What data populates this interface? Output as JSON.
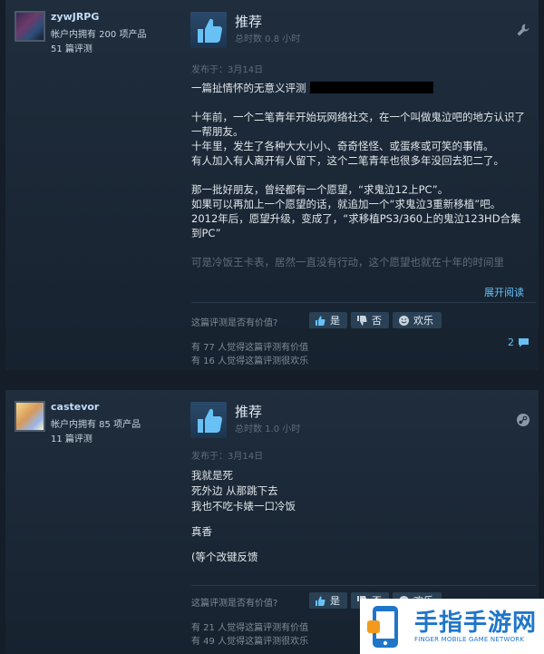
{
  "reviews": [
    {
      "user": {
        "name": "zywJRPG",
        "owned": "帐户内拥有 200 项产品",
        "reviews": "51 篇评测"
      },
      "verdict": "推荐",
      "hours": "总时数 0.8 小时",
      "posted": "发布于：3月14日",
      "lines": [
        "一篇扯情怀的无意义评测",
        "",
        "十年前，一个二笔青年开始玩网络社交，在一个叫做鬼泣吧的地方认识了一帮朋友。",
        "十年里，发生了各种大大小小、奇奇怪怪、或蛋疼或可笑的事情。",
        "有人加入有人离开有人留下，这个二笔青年也很多年没回去犯二了。",
        "",
        "那一批好朋友，曾经都有一个愿望，“求鬼泣12上PC”。",
        "如果可以再加上一个愿望的话，就追加一个“求鬼泣3重新移植”吧。",
        "2012年后，愿望升级，变成了，“求移植PS3/360上的鬼泣123HD合集到PC”",
        "",
        "可是冷饭王卡表，居然一直没有行动，这个愿望也就在十年的时间里"
      ],
      "expand": "展开阅读",
      "helpful_q": "这篇评测是否有价值?",
      "vote_yes": "是",
      "vote_no": "否",
      "vote_funny": "欢乐",
      "helpful_count": "有 77 人觉得这篇评测有价值",
      "funny_count": "有 16 人觉得这篇评测很欢乐",
      "comments": "2"
    },
    {
      "user": {
        "name": "castevor",
        "owned": "帐户内拥有 85 项产品",
        "reviews": "11 篇评测"
      },
      "verdict": "推荐",
      "hours": "总时数 1.0 小时",
      "posted": "发布于：3月14日",
      "lines": [
        "我就是死",
        "死外边 从那跳下去",
        "我也不吃卡婊一口冷饭",
        "",
        "真香",
        "",
        "(等个改键反馈"
      ],
      "helpful_q": "这篇评测是否有价值?",
      "vote_yes": "是",
      "vote_no": "否",
      "vote_funny": "欢乐",
      "helpful_count": "有 21 人觉得这篇评测有价值",
      "funny_count": "有 49 人觉得这篇评测很欢乐"
    }
  ],
  "watermark": {
    "cn": "手指手游网",
    "en": "FINGER MOBILE GAME NETWORK"
  },
  "colors": {
    "link": "#66c0f4",
    "background": "#141d28",
    "card": "#1f2d3d"
  }
}
